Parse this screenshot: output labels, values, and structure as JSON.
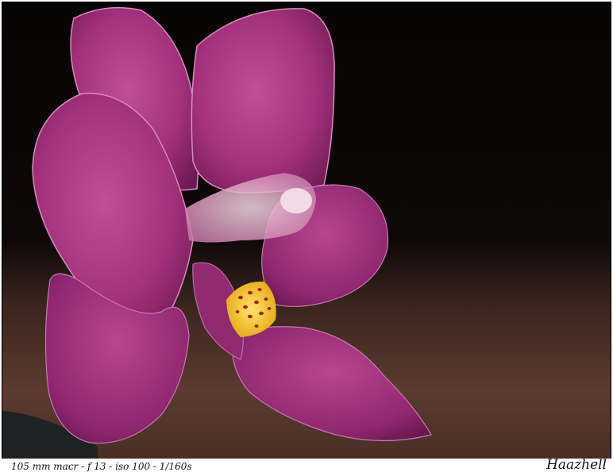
{
  "photo": {
    "subject": "pink orchid macro photograph",
    "colors": {
      "background_dark": "#0b0706",
      "background_warm": "#5a3a30",
      "petal": "#a8347e",
      "petal_light": "#d77ab8",
      "column": "#f2d08a",
      "lip_yellow": "#f2c21a",
      "spots": "#9a2a1c"
    }
  },
  "caption": {
    "exif_text": "105 mm macr - f 13 - iso 100 - 1/160s",
    "signature": "Haazhell"
  }
}
